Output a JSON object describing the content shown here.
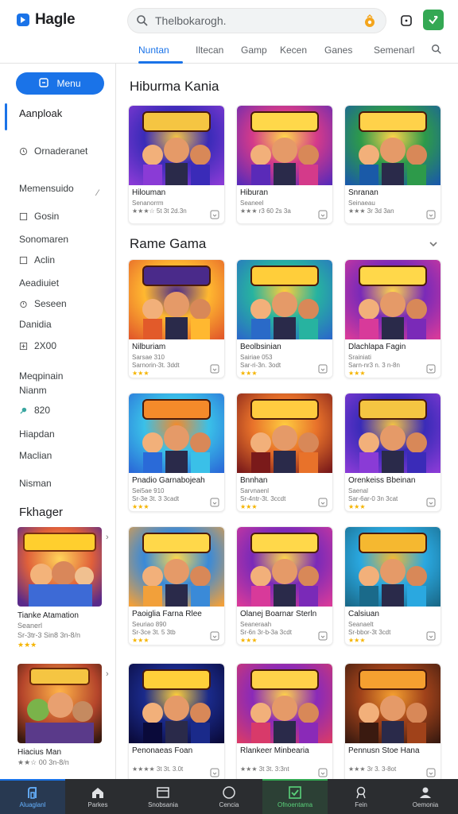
{
  "header": {
    "logo_text": "Hagle",
    "search_value": "Thelbokarogh.",
    "tabs": [
      "Nuntan",
      "Iltecan",
      "Gamp",
      "Kecen",
      "Ganes",
      "Semenarl"
    ]
  },
  "sidebar": {
    "menu_button": "Menu",
    "items": [
      {
        "label": "Aanploak",
        "icon": "none"
      },
      {
        "label": "Ornaderanet",
        "icon": "clock-icon"
      },
      {
        "label": "Memensuido",
        "icon": "none"
      },
      {
        "label": "Gosin",
        "icon": "square-icon"
      },
      {
        "label": "Sonomaren",
        "icon": "none"
      },
      {
        "label": "Aclin",
        "icon": "square-icon"
      },
      {
        "label": "Aeadiuiet",
        "icon": "none"
      },
      {
        "label": "Seseen",
        "icon": "timer-icon"
      },
      {
        "label": "Danidia",
        "icon": "none"
      },
      {
        "label": "2X00",
        "icon": "plus-box-icon"
      },
      {
        "label": "Meqpinain",
        "icon": "none"
      },
      {
        "label": "Nianm",
        "icon": "none"
      },
      {
        "label": "820",
        "icon": "pin-icon"
      },
      {
        "label": "Hiapdan",
        "icon": "none"
      },
      {
        "label": "Maclian",
        "icon": "none"
      },
      {
        "label": "Nisman",
        "icon": "none"
      }
    ],
    "featured_title": "Fkhager",
    "featured_cards": [
      {
        "name": "Tianke Atamation",
        "sub": "Seanerl",
        "meta": "Sr-3tr-3 Sin8 3n-8/n",
        "stars": "★★★"
      },
      {
        "name": "Hiacius Man",
        "sub": "",
        "meta": "★★☆ 00 3n-8/n",
        "stars": ""
      }
    ]
  },
  "sections": [
    {
      "title": "Hiburma Kania",
      "cards": [
        {
          "name": "Hilouman",
          "sub": "Senanorrm",
          "meta": "★★★☆ 5t 3t 2d.3n",
          "palette": "purple"
        },
        {
          "name": "Hiburan",
          "sub": "Seaneel",
          "meta": "★★★ r3 60 2s 3a",
          "palette": "magenta"
        },
        {
          "name": "Snranan",
          "sub": "Seinaeau",
          "meta": "★★★ 3r  3d 3an",
          "palette": "green"
        }
      ]
    },
    {
      "title": "Rame Gama",
      "cards": [
        {
          "name": "Nilburiam",
          "sub": "Sarsae 310",
          "meta": "Sarnorin-3t. 3ddt",
          "stars": "★★★",
          "palette": "yellow"
        },
        {
          "name": "Beolbsinian",
          "sub": "Sairiae 053",
          "meta": "Sar-ri-3n. 3odt",
          "stars": "★★★",
          "palette": "teal"
        },
        {
          "name": "Dlachlapa Fagin",
          "sub": "Srainiati",
          "meta": "Sarn-nr3 n. 3 n-8n",
          "stars": "★★★",
          "palette": "violet"
        },
        {
          "name": "Pnadio Garnabojeah",
          "sub": "Sei5ae 910",
          "meta": "Sr-3e 3t. 3 3cadt",
          "stars": "★★★",
          "palette": "cyan"
        },
        {
          "name": "Bnnhan",
          "sub": "Sarvnaenl",
          "meta": "Sr-4ntr-3t. 3ccdt",
          "stars": "★★★",
          "palette": "orange"
        },
        {
          "name": "Orenkeiss Bbeinan",
          "sub": "Saenal",
          "meta": "Sar-6ar-0 3n 3cat",
          "stars": "★★★",
          "palette": "purple"
        },
        {
          "name": "Paoiglia Farna Rlee",
          "sub": "Seuriao 890",
          "meta": "Sr-3ce 3t. 5 3tb",
          "stars": "★★★",
          "palette": "city"
        },
        {
          "name": "Olanej Boarnar Sterln",
          "sub": "Seaneraah",
          "meta": "Sr-6n 3r-b-3a 3cdt",
          "stars": "★★★",
          "palette": "violet"
        },
        {
          "name": "Calsiuan",
          "sub": "Seanaelt",
          "meta": "Sr-bbor-3t 3cdt",
          "stars": "★★★",
          "palette": "blue"
        },
        {
          "name": "Penonaeas Foan",
          "sub": "",
          "meta": "★★★★ 3t 3t. 3.0t",
          "stars": "",
          "palette": "storm"
        },
        {
          "name": "Rlankeer Minbearia",
          "sub": "",
          "meta": "★★★ 3t 3t. 3:3nt",
          "stars": "",
          "palette": "pink"
        },
        {
          "name": "Pennusn Stoe Hana",
          "sub": "",
          "meta": "★★★ 3r 3. 3-8ot",
          "stars": "",
          "palette": "brown"
        }
      ]
    }
  ],
  "bottom_nav": [
    {
      "label": "Aluaglanl",
      "icon": "home-icon"
    },
    {
      "label": "Parkes",
      "icon": "house-icon"
    },
    {
      "label": "Snobsania",
      "icon": "window-icon"
    },
    {
      "label": "Cencia",
      "icon": "circle-icon"
    },
    {
      "label": "Ofnoentama",
      "icon": "check-box-icon"
    },
    {
      "label": "Fein",
      "icon": "pin-icon"
    },
    {
      "label": "Oemonia",
      "icon": "user-icon"
    }
  ],
  "colors": {
    "accent": "#1a73e8",
    "green": "#34a853",
    "star": "#f5b400",
    "bottom_bar": "#2b2d30"
  }
}
